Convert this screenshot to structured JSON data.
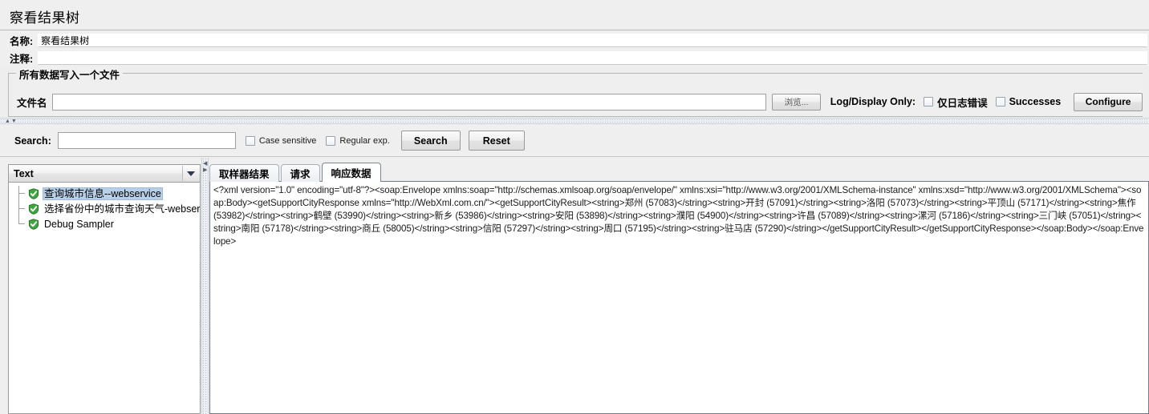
{
  "window": {
    "title": "察看结果树"
  },
  "form": {
    "name_label": "名称:",
    "name_value": "察看结果树",
    "comment_label": "注释:",
    "comment_value": ""
  },
  "file_group": {
    "legend": "所有数据写入一个文件",
    "filename_label": "文件名",
    "filename_value": "",
    "filename_placeholder": "",
    "browse_button": "浏览...",
    "log_display_label": "Log/Display Only:",
    "errors_checkbox": "仅日志错误",
    "errors_checked": false,
    "successes_checkbox": "Successes",
    "successes_checked": false,
    "configure_button": "Configure"
  },
  "search": {
    "label": "Search:",
    "value": "",
    "placeholder": "",
    "case_sensitive_label": "Case sensitive",
    "case_sensitive_checked": false,
    "regular_exp_label": "Regular exp.",
    "regular_exp_checked": false,
    "search_button": "Search",
    "reset_button": "Reset"
  },
  "left_pane": {
    "renderer_selected": "Text",
    "tree_items": [
      {
        "label": "查询城市信息--webservice",
        "status": "success",
        "selected": true
      },
      {
        "label": "选择省份中的城市查询天气-webserv",
        "status": "success",
        "selected": false
      },
      {
        "label": "Debug Sampler",
        "status": "success",
        "selected": false
      }
    ]
  },
  "right_pane": {
    "tabs": [
      {
        "label": "取样器结果",
        "active": false
      },
      {
        "label": "请求",
        "active": false
      },
      {
        "label": "响应数据",
        "active": true
      }
    ],
    "response_body": "<?xml version=\"1.0\" encoding=\"utf-8\"?><soap:Envelope xmlns:soap=\"http://schemas.xmlsoap.org/soap/envelope/\" xmlns:xsi=\"http://www.w3.org/2001/XMLSchema-instance\" xmlns:xsd=\"http://www.w3.org/2001/XMLSchema\"><soap:Body><getSupportCityResponse xmlns=\"http://WebXml.com.cn/\"><getSupportCityResult><string>郑州 (57083)</string><string>开封 (57091)</string><string>洛阳 (57073)</string><string>平顶山 (57171)</string><string>焦作 (53982)</string><string>鹤壁 (53990)</string><string>新乡 (53986)</string><string>安阳 (53898)</string><string>濮阳 (54900)</string><string>许昌 (57089)</string><string>漯河 (57186)</string><string>三门峡 (57051)</string><string>南阳 (57178)</string><string>商丘 (58005)</string><string>信阳 (57297)</string><string>周口 (57195)</string><string>驻马店 (57290)</string></getSupportCityResult></getSupportCityResponse></soap:Body></soap:Envelope>"
  },
  "colors": {
    "accent": "#b8cfe8",
    "success_icon": "#3fa63f",
    "panel_bg": "#efefef"
  }
}
